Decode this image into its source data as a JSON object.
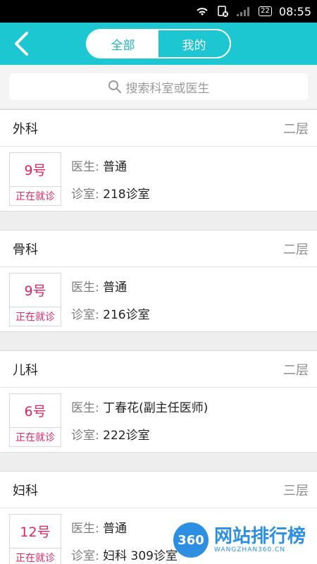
{
  "status_bar": {
    "time": "08:55",
    "battery": "22"
  },
  "header": {
    "back_icon": "chevron-left-icon",
    "tabs": [
      {
        "label": "全部",
        "active": true
      },
      {
        "label": "我的",
        "active": false
      }
    ]
  },
  "search": {
    "placeholder": "搜索科室或医生",
    "icon": "search-icon"
  },
  "departments": [
    {
      "name": "外科",
      "floor": "二层",
      "number": "9号",
      "state": "正在就诊",
      "doctor_label": "医生:",
      "doctor": "普通",
      "room_label": "诊室:",
      "room": "218诊室"
    },
    {
      "name": "骨科",
      "floor": "二层",
      "number": "9号",
      "state": "正在就诊",
      "doctor_label": "医生:",
      "doctor": "普通",
      "room_label": "诊室:",
      "room": "216诊室"
    },
    {
      "name": "儿科",
      "floor": "二层",
      "number": "6号",
      "state": "正在就诊",
      "doctor_label": "医生:",
      "doctor": "丁春花(副主任医师)",
      "room_label": "诊室:",
      "room": "222诊室"
    },
    {
      "name": "妇科",
      "floor": "三层",
      "number": "12号",
      "state": "正在就诊",
      "doctor_label": "医生:",
      "doctor": "普通",
      "room_label": "诊室:",
      "room": "妇科 309诊室"
    }
  ],
  "watermark": {
    "logo": "360",
    "title": "网站排行榜",
    "subtitle": "WANGZHAN360.CN"
  },
  "colors": {
    "header": "#1dc7d2",
    "accent": "#e0245e"
  }
}
